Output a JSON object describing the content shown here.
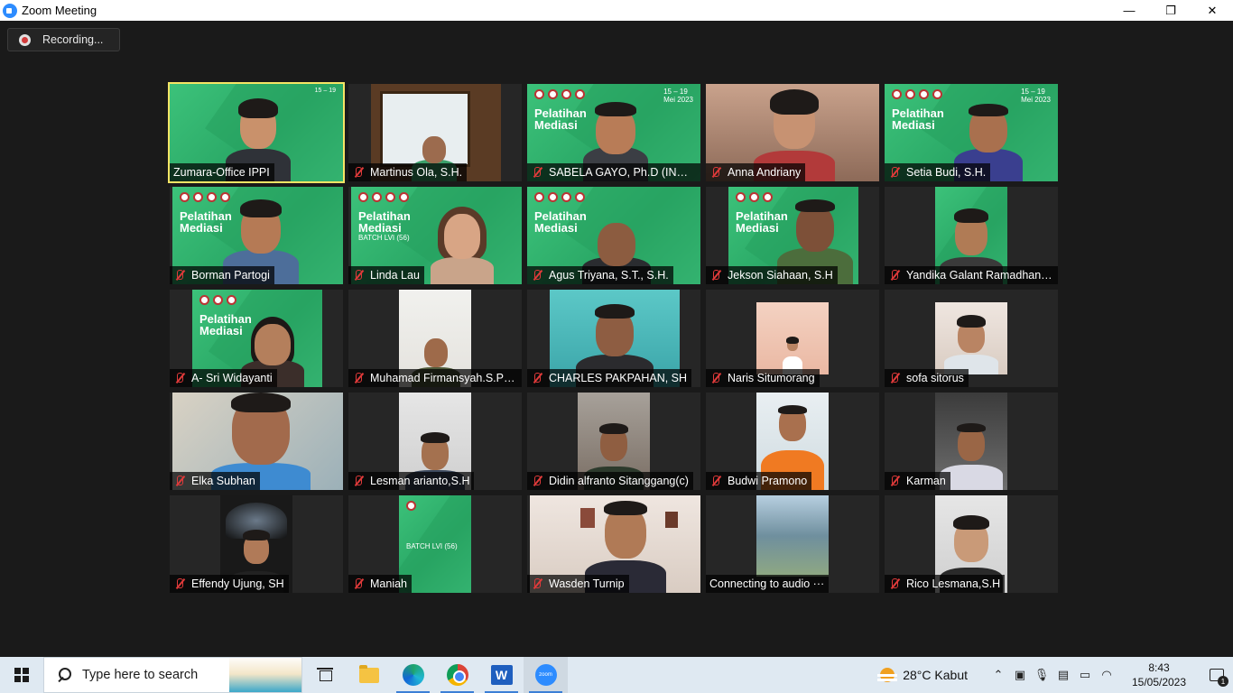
{
  "window": {
    "title": "Zoom Meeting",
    "controls": {
      "minimize": "—",
      "maximize": "❐",
      "close": "✕"
    }
  },
  "recording": {
    "label": "Recording..."
  },
  "participants": [
    {
      "name": "Zumara-Office IPPI",
      "muted": false,
      "active": true
    },
    {
      "name": "Martinus Ola, S.H.",
      "muted": true
    },
    {
      "name": "SABELA GAYO, Ph.D (INDO...",
      "muted": true
    },
    {
      "name": "Anna Andriany",
      "muted": true
    },
    {
      "name": "Setia Budi, S.H.",
      "muted": true
    },
    {
      "name": "Borman Partogi",
      "muted": true
    },
    {
      "name": "Linda Lau",
      "muted": true
    },
    {
      "name": "Agus Triyana, S.T., S.H.",
      "muted": true
    },
    {
      "name": "Jekson Siahaan, S.H",
      "muted": true
    },
    {
      "name": "Yandika Galant Ramadhan, ...",
      "muted": true
    },
    {
      "name": "A- Sri Widayanti",
      "muted": true
    },
    {
      "name": "Muhamad Firmansyah.S.Pt....",
      "muted": true
    },
    {
      "name": "CHARLES PAKPAHAN, SH",
      "muted": true
    },
    {
      "name": "Naris Situmorang",
      "muted": true
    },
    {
      "name": "sofa sitorus",
      "muted": true
    },
    {
      "name": "Elka Subhan",
      "muted": true
    },
    {
      "name": "Lesman arianto,S.H",
      "muted": true
    },
    {
      "name": "Didin alfranto Sitanggang(c)",
      "muted": true
    },
    {
      "name": "Budwi Pramono",
      "muted": true
    },
    {
      "name": "Karman",
      "muted": true
    },
    {
      "name": "Effendy Ujung, SH",
      "muted": true
    },
    {
      "name": "Maniah",
      "muted": true
    },
    {
      "name": "Wasden Turnip",
      "muted": true
    },
    {
      "name": "Connecting to audio ···",
      "muted": false
    },
    {
      "name": "Rico Lesmana,S.H",
      "muted": true
    }
  ],
  "background_branding": {
    "title_line1": "Pelatihan",
    "title_line2": "Mediasi",
    "batch": "BATCH LVI (56)",
    "dates": "15 – 19",
    "month": "Mei 2023"
  },
  "taskbar": {
    "search_placeholder": "Type here to search",
    "weather": "28°C  Kabut",
    "time": "8:43",
    "date": "15/05/2023",
    "notification_count": "1"
  }
}
